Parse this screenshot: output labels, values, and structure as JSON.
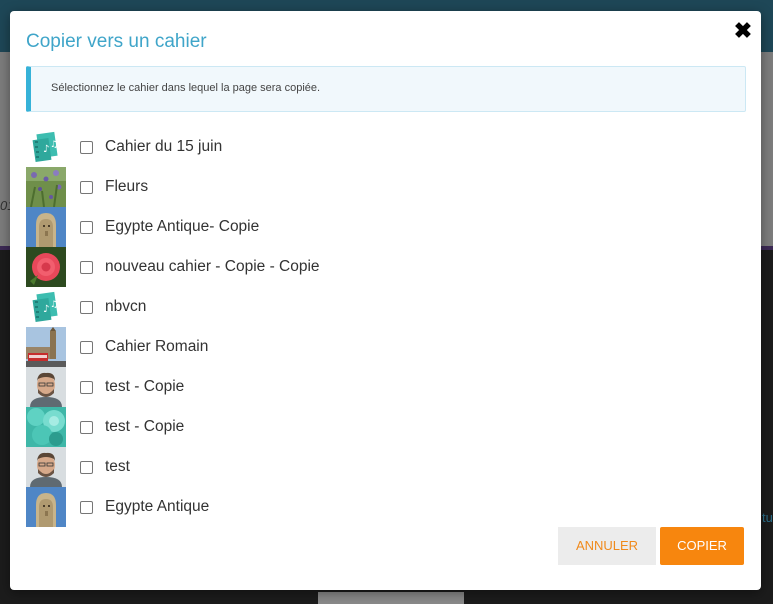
{
  "background": {
    "left_edge_text": "01",
    "right_edge_text": "tu"
  },
  "dialog": {
    "title": "Copier vers un cahier",
    "close_icon": "close-icon",
    "info": "Sélectionnez le cahier dans lequel la page sera copiée.",
    "notebooks": [
      {
        "label": "Cahier du 15 juin",
        "thumb": "music-notebook",
        "checked": false
      },
      {
        "label": "Fleurs",
        "thumb": "flowers-photo",
        "checked": false
      },
      {
        "label": "Egypte Antique- Copie",
        "thumb": "statue-photo",
        "checked": false
      },
      {
        "label": "nouveau cahier - Copie - Copie",
        "thumb": "rose-photo",
        "checked": false
      },
      {
        "label": "nbvcn",
        "thumb": "music-notebook",
        "checked": false
      },
      {
        "label": "Cahier Romain",
        "thumb": "london-photo",
        "checked": false
      },
      {
        "label": "test - Copie",
        "thumb": "portrait-photo",
        "checked": false
      },
      {
        "label": "test - Copie",
        "thumb": "cupcake-photo",
        "checked": false
      },
      {
        "label": "test",
        "thumb": "portrait-photo",
        "checked": false
      },
      {
        "label": "Egypte Antique",
        "thumb": "statue-photo",
        "checked": false
      }
    ],
    "buttons": {
      "cancel": "ANNULER",
      "copy": "COPIER"
    }
  },
  "colors": {
    "title": "#3fa5c9",
    "accent": "#f7860e",
    "info_border": "#36b2d8"
  }
}
